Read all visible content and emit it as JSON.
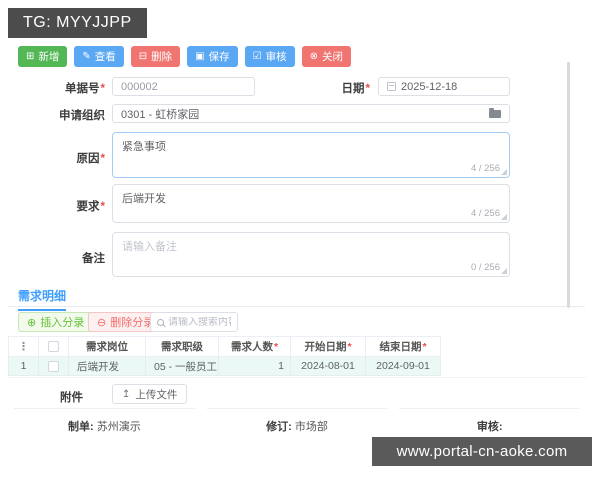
{
  "window": {
    "title": "TG: MYYJJPP"
  },
  "required_mark": "*",
  "colors": {
    "titlebar": "#4c4c4c",
    "primary": "#5aa7f3",
    "success": "#53b755",
    "danger": "#f07470",
    "accent": "#409eff",
    "row_highlight": "#eaf8f6"
  },
  "toolbar": {
    "buttons": [
      {
        "label": "新增",
        "icon": "⊞",
        "type": "success"
      },
      {
        "label": "查看",
        "icon": "✎",
        "type": "primary"
      },
      {
        "label": "删除",
        "icon": "⊟",
        "type": "danger"
      },
      {
        "label": "保存",
        "icon": "▣",
        "type": "primary"
      },
      {
        "label": "审核",
        "icon": "☑",
        "type": "primary"
      },
      {
        "label": "关闭",
        "icon": "⊗",
        "type": "danger"
      }
    ]
  },
  "form": {
    "doc_no": {
      "label": "单据号",
      "value": "000002",
      "required": true
    },
    "date": {
      "label": "日期",
      "value": "2025-12-18",
      "required": true
    },
    "org": {
      "label": "申请组织",
      "value": "0301 - 虹桥家园"
    },
    "reason": {
      "label": "原因",
      "value": "紧急事项",
      "counter": "4 / 256",
      "required": true
    },
    "demand": {
      "label": "要求",
      "value": "后端开发",
      "counter": "4 / 256",
      "required": true
    },
    "remark": {
      "label": "备注",
      "placeholder": "请输入备注",
      "counter": "0 / 256"
    }
  },
  "detail": {
    "tab": "需求明细",
    "insert_label": "插入分录",
    "insert_icon": "⊕",
    "delete_label": "删除分录",
    "delete_icon": "⊖",
    "search_placeholder": "请输入搜索内容",
    "table": {
      "drag_glyph": "⋮",
      "headers": {
        "post": "需求岗位",
        "level": "需求职级",
        "count": "需求人数",
        "start": "开始日期",
        "end": "结束日期"
      },
      "rows": [
        {
          "index": "1",
          "post": "后端开发",
          "level": "05 - 一般员工",
          "count": "1",
          "start": "2024-08-01",
          "end": "2024-09-01"
        }
      ]
    }
  },
  "attachment": {
    "label": "附件",
    "upload_label": "上传文件",
    "upload_icon": "↥"
  },
  "footer": {
    "maker_label": "制单:",
    "maker_value": "苏州演示",
    "revise_label": "修订:",
    "revise_value": "市场部",
    "audit_label": "审核:",
    "audit_value": ""
  },
  "watermark": "www.portal-cn-aoke.com"
}
